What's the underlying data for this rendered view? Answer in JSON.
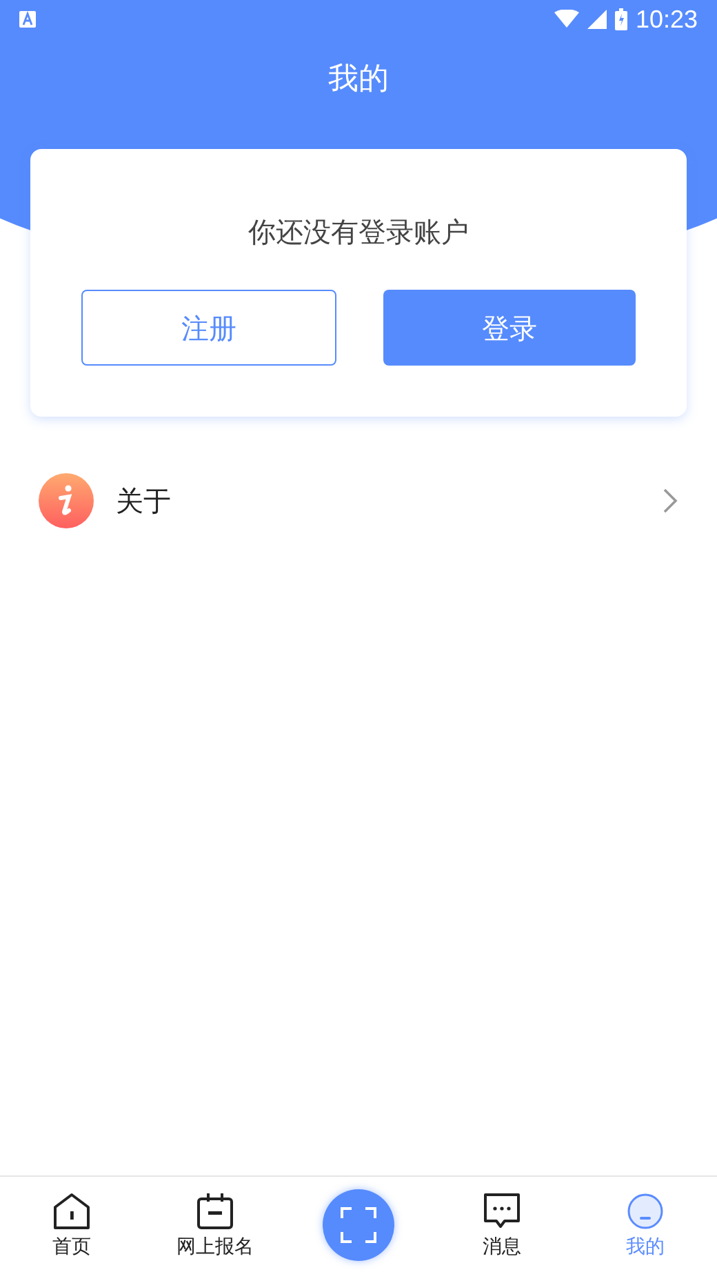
{
  "status_bar": {
    "time": "10:23"
  },
  "header": {
    "title": "我的"
  },
  "login_card": {
    "message": "你还没有登录账户",
    "register_button": "注册",
    "login_button": "登录"
  },
  "menu": [
    {
      "label": "关于"
    }
  ],
  "bottom_nav": [
    {
      "kind": "tab",
      "label": "首页",
      "selected": false
    },
    {
      "kind": "tab",
      "label": "网上报名",
      "selected": false
    },
    {
      "kind": "scan"
    },
    {
      "kind": "tab",
      "label": "消息",
      "selected": false
    },
    {
      "kind": "tab",
      "label": "我的",
      "selected": true
    }
  ]
}
